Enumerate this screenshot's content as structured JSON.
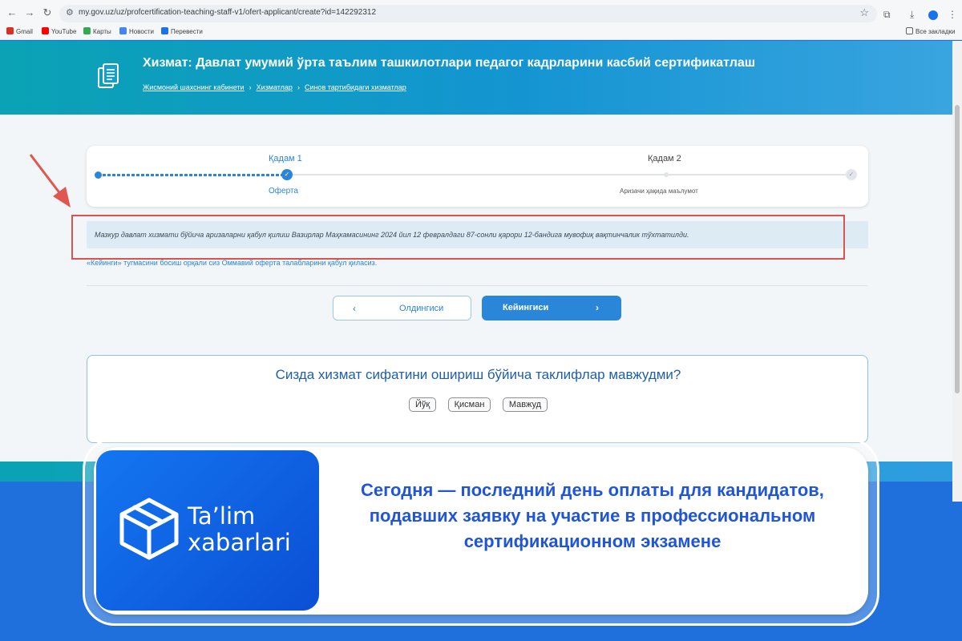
{
  "browser": {
    "url": "my.gov.uz/uz/profcertification-teaching-staff-v1/ofert-applicant/create?id=142292312",
    "bookmarks": [
      {
        "label": "Gmail",
        "color": "#d93025"
      },
      {
        "label": "YouTube",
        "color": "#ff0000"
      },
      {
        "label": "Карты",
        "color": "#34a853"
      },
      {
        "label": "Новости",
        "color": "#4285f4"
      },
      {
        "label": "Перевести",
        "color": "#1a73e8"
      }
    ],
    "all_bookmarks": "Все закладки"
  },
  "header": {
    "title": "Хизмат: Давлат умумий ўрта таълим ташкилотлари педагог кадрларини касбий сертификатлаш",
    "breadcrumbs": [
      "Жисмоний шахснинг кабинети",
      "Хизматлар",
      "Синов тартибидаги хизматлар"
    ]
  },
  "stepper": {
    "step1_title": "Қадам 1",
    "step1_label": "Оферта",
    "step2_title": "Қадам 2",
    "step2_label": "Аризачи ҳақида маълумот"
  },
  "notice": "Мазкур давлат хизмати бўйича аризаларни қабул қилиш Вазирлар Маҳкамасининг 2024 йил 12 февралдаги 87-сонли қарори 12-бандига мувофиқ вақтинчалик тўхтатилди.",
  "offer_note": "«Кейинги» тугмасини босиш орқали сиз Оммавий оферта талабларини қабул қиласиз.",
  "buttons": {
    "prev": "Олдингиси",
    "next": "Кейингиси"
  },
  "survey": {
    "question": "Сизда хизмат сифатини ошириш бўйича таклифлар мавжудми?",
    "options": [
      "Йўқ",
      "Қисман",
      "Мавжуд"
    ]
  },
  "news": {
    "brand": "Ta’lim xabarlari",
    "brand_line1": "Ta’lim",
    "brand_line2": "xabarlari",
    "headline": "Сегодня — последний день оплаты для кандидатов, подавших заявку на участие в профессиональном сертификационном экзамене"
  },
  "colors": {
    "accent": "#2a86d9",
    "alert_border": "#d9534f",
    "news_blue": "#1f55d6"
  }
}
